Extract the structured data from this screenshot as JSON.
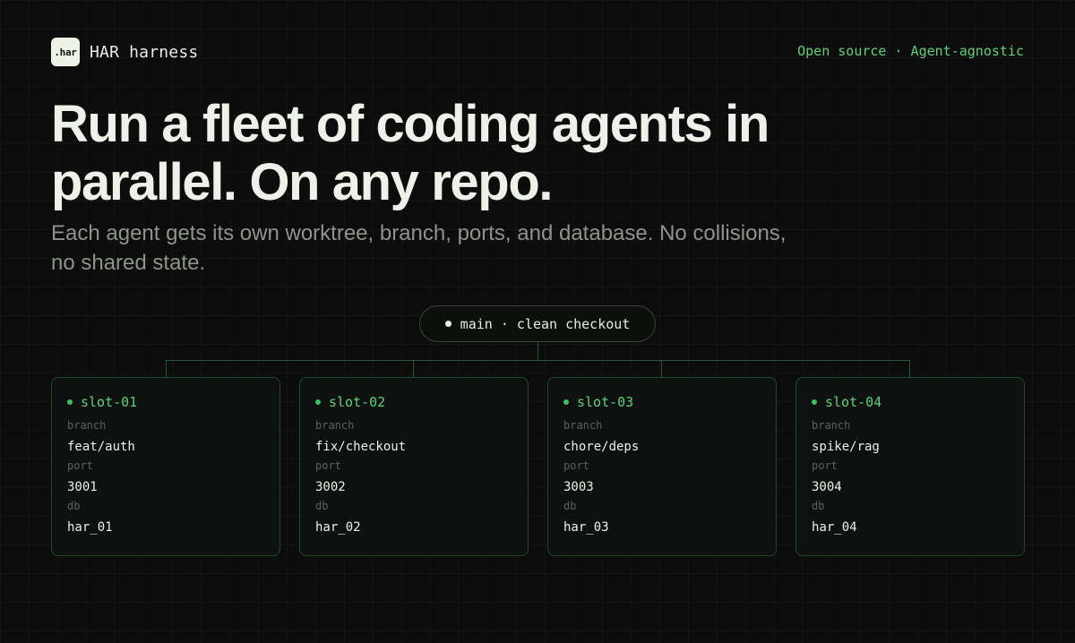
{
  "brand": {
    "logo_text": ".har",
    "name": "HAR harness"
  },
  "tagline": "Open source · Agent-agnostic",
  "hero": {
    "headline": "Run a fleet of coding agents in parallel. On any repo.",
    "subhead": "Each agent gets its own worktree, branch, ports, and database. No collisions, no shared state."
  },
  "main_branch": {
    "label": "main · clean checkout"
  },
  "slots": [
    {
      "name": "slot-01",
      "branch_label": "branch",
      "branch": "feat/auth",
      "port_label": "port",
      "port": "3001",
      "db_label": "db",
      "db": "har_01"
    },
    {
      "name": "slot-02",
      "branch_label": "branch",
      "branch": "fix/checkout",
      "port_label": "port",
      "port": "3002",
      "db_label": "db",
      "db": "har_02"
    },
    {
      "name": "slot-03",
      "branch_label": "branch",
      "branch": "chore/deps",
      "port_label": "port",
      "port": "3003",
      "db_label": "db",
      "db": "har_03"
    },
    {
      "name": "slot-04",
      "branch_label": "branch",
      "branch": "spike/rag",
      "port_label": "port",
      "port": "3004",
      "db_label": "db",
      "db": "har_04"
    }
  ],
  "colors": {
    "background": "#0b0c0b",
    "accent_green": "#5fd07c",
    "connector": "#1f5a31",
    "text": "#eef1ea",
    "muted": "#8e948c"
  }
}
